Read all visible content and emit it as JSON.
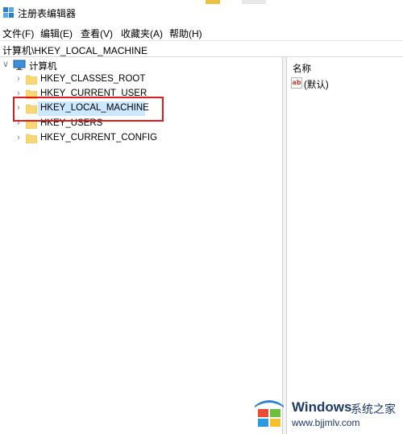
{
  "window": {
    "title": "注册表编辑器"
  },
  "menu": [
    {
      "label": "文件(F)"
    },
    {
      "label": "编辑(E)"
    },
    {
      "label": "查看(V)"
    },
    {
      "label": "收藏夹(A)"
    },
    {
      "label": "帮助(H)"
    }
  ],
  "address": {
    "path": "计算机\\HKEY_LOCAL_MACHINE"
  },
  "tree": {
    "root": {
      "label": "计算机"
    },
    "hives": [
      {
        "label": "HKEY_CLASSES_ROOT"
      },
      {
        "label": "HKEY_CURRENT_USER"
      },
      {
        "label": "HKEY_LOCAL_MACHINE"
      },
      {
        "label": "HKEY_USERS"
      },
      {
        "label": "HKEY_CURRENT_CONFIG"
      }
    ]
  },
  "list": {
    "column_name": "名称",
    "values": [
      {
        "name": "(默认)"
      }
    ]
  },
  "watermark": {
    "brand": "Windows",
    "brand_cn": "系统之家",
    "url": "www.bjjmlv.com"
  },
  "colors": {
    "selection": "#cce8ff",
    "highlight_border": "#e0191d",
    "folder": "#f8d775"
  }
}
